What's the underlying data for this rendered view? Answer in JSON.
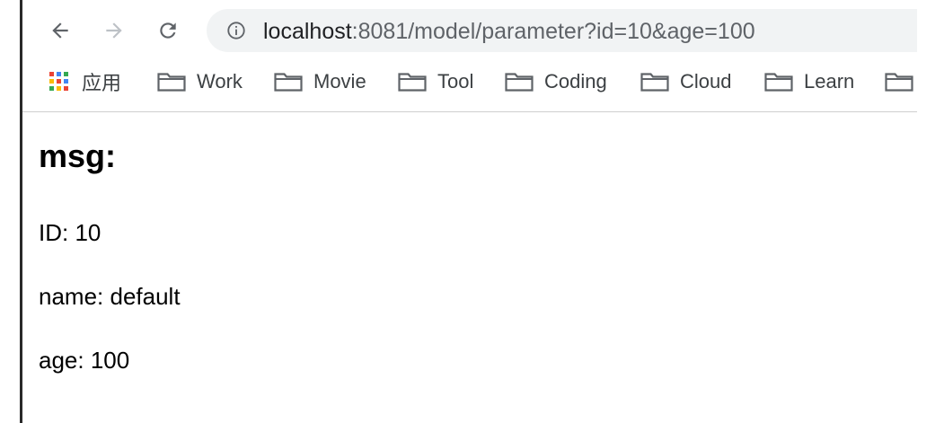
{
  "browser": {
    "nav": {
      "back_icon": "arrow-left-icon",
      "forward_icon": "arrow-right-icon",
      "reload_icon": "reload-icon"
    },
    "address_bar": {
      "info_icon": "info-circle-icon",
      "host": "localhost",
      "path": ":8081/model/parameter?id=10&age=100"
    },
    "bookmarks": [
      {
        "label": "应用",
        "icon": "apps-grid-icon"
      },
      {
        "label": "Work",
        "icon": "folder-icon"
      },
      {
        "label": "Movie",
        "icon": "folder-icon"
      },
      {
        "label": "Tool",
        "icon": "folder-icon"
      },
      {
        "label": "Coding",
        "icon": "folder-icon"
      },
      {
        "label": "Cloud",
        "icon": "folder-icon"
      },
      {
        "label": "Learn",
        "icon": "folder-icon"
      },
      {
        "label": "",
        "icon": "folder-icon"
      }
    ]
  },
  "page": {
    "heading": "msg:",
    "lines": [
      "ID: 10",
      "name: default",
      "age: 100"
    ]
  },
  "colors": {
    "apps_grid": [
      "#ea4335",
      "#4285f4",
      "#34a853",
      "#fbbc05",
      "#ea4335",
      "#4285f4",
      "#34a853",
      "#fbbc05",
      "#ea4335"
    ]
  }
}
